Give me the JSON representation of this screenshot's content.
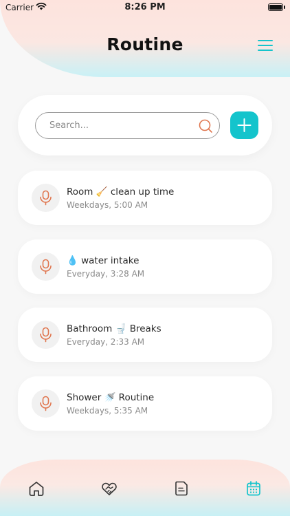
{
  "status_bar": {
    "carrier": "Carrier",
    "time": "8:26 PM"
  },
  "header": {
    "title": "Routine"
  },
  "search": {
    "placeholder": "Search..."
  },
  "routines": [
    {
      "title": "Room  🧹 clean up time",
      "schedule": "Weekdays, 5:00 AM"
    },
    {
      "title": "💧 water intake",
      "schedule": "Everyday, 3:28 AM"
    },
    {
      "title": "Bathroom 🚽 Breaks",
      "schedule": "Everyday, 2:33 AM"
    },
    {
      "title": "Shower 🚿 Routine",
      "schedule": "Weekdays, 5:35 AM"
    }
  ],
  "tabs": [
    {
      "icon": "home-icon",
      "active": false
    },
    {
      "icon": "heart-handshake-icon",
      "active": false
    },
    {
      "icon": "notes-icon",
      "active": false
    },
    {
      "icon": "calendar-icon",
      "active": true
    }
  ],
  "colors": {
    "accent": "#14c4cc",
    "mic": "#e0764f",
    "search_icon": "#e0764f",
    "tab_inactive": "#333333"
  }
}
